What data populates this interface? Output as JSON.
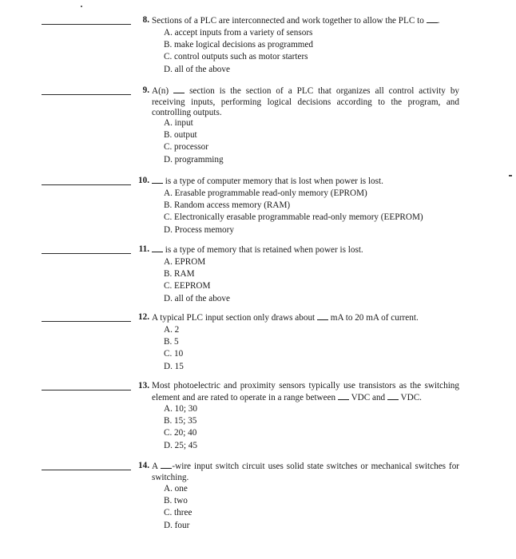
{
  "worksheet": {
    "questions": [
      {
        "number": "8.",
        "text_before": "Sections of a PLC are interconnected and work together to allow the PLC to",
        "text_after": ".",
        "options": [
          "A. accept inputs from a variety of sensors",
          "B. make logical decisions as programmed",
          "C. control outputs such as motor starters",
          "D. all of the above"
        ]
      },
      {
        "number": "9.",
        "text_before": "A(n)",
        "text_after": "section is the section of a PLC that organizes all control activity by receiving inputs, performing logical decisions according to the program, and controlling outputs.",
        "options": [
          "A. input",
          "B. output",
          "C. processor",
          "D. programming"
        ]
      },
      {
        "number": "10.",
        "text_before": "",
        "text_after": "is a type of computer memory that is lost when power is lost.",
        "options": [
          "A. Erasable programmable read-only memory (EPROM)",
          "B. Random access memory (RAM)",
          "C. Electronically erasable programmable read-only memory (EEPROM)",
          "D. Process memory"
        ]
      },
      {
        "number": "11.",
        "text_before": "",
        "text_after": "is a type of memory that is retained when power is lost.",
        "options": [
          "A. EPROM",
          "B. RAM",
          "C. EEPROM",
          "D. all of the above"
        ]
      },
      {
        "number": "12.",
        "text_before": "A typical PLC input section only draws about",
        "text_after": "mA to 20 mA of current.",
        "options": [
          "A. 2",
          "B. 5",
          "C. 10",
          "D. 15"
        ]
      },
      {
        "number": "13.",
        "text_before": "Most photoelectric and proximity sensors typically use transistors as the switching element and are rated to operate in a range between",
        "text_middle": "VDC and",
        "text_after": "VDC.",
        "options": [
          "A. 10; 30",
          "B. 15; 35",
          "C. 20; 40",
          "D. 25; 45"
        ]
      },
      {
        "number": "14.",
        "text_before": "A",
        "text_after": "-wire input switch circuit uses solid state switches or mechanical switches for switching.",
        "options": [
          "A. one",
          "B. two",
          "C. three",
          "D. four"
        ]
      }
    ]
  }
}
